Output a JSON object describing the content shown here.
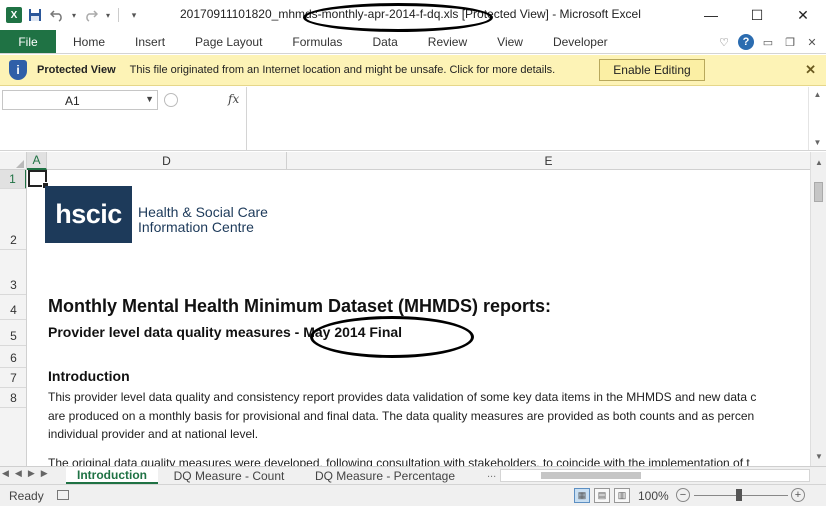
{
  "window": {
    "title": "20170911101820_mhmds-monthly-apr-2014-f-dq.xls  [Protected View]  -  Microsoft Excel",
    "app_icon": "X",
    "controls": {
      "minimize": "—",
      "maximize": "☐",
      "close": "✕"
    }
  },
  "ribbon": {
    "file": "File",
    "tabs": [
      "Home",
      "Insert",
      "Page Layout",
      "Formulas",
      "Data",
      "Review",
      "View",
      "Developer"
    ]
  },
  "protected_view": {
    "icon": "i",
    "title": "Protected View",
    "message": "This file originated from an Internet location and might be unsafe. Click for more details.",
    "enable_button": "Enable Editing",
    "close": "✕"
  },
  "formula_bar": {
    "name_box": "A1",
    "fx": "fx",
    "formula": ""
  },
  "grid": {
    "columns": [
      {
        "label": "A",
        "selected": true
      },
      {
        "label": "D",
        "selected": false
      },
      {
        "label": "E",
        "selected": false
      }
    ],
    "rows": [
      {
        "label": "1",
        "selected": true
      },
      {
        "label": "2",
        "selected": false
      },
      {
        "label": "3",
        "selected": false
      },
      {
        "label": "4",
        "selected": false
      },
      {
        "label": "5",
        "selected": false
      },
      {
        "label": "6",
        "selected": false
      },
      {
        "label": "7",
        "selected": false
      },
      {
        "label": "8",
        "selected": false
      }
    ]
  },
  "content": {
    "logo_mark": "hscic",
    "logo_line1": "Health & Social Care",
    "logo_line2": "Information Centre",
    "main_heading": "Monthly Mental Health Minimum Dataset (MHMDS) reports:",
    "sub_heading": "Provider level data quality measures - May 2014 Final",
    "intro_heading": "Introduction",
    "intro_lines": [
      "This provider level data quality and consistency report provides data validation of some key data items in the MHMDS and new data c",
      "are produced on a monthly basis for provisional and final data. The data quality measures are provided as both counts and as percen",
      "individual provider and at national level."
    ],
    "intro_line_cut": "The original data quality measures were developed, following consultation with stakeholders, to coincide with the implementation of t"
  },
  "sheet_tabs": {
    "tabs": [
      "Introduction",
      "DQ Measure - Count",
      "DQ Measure - Percentage"
    ],
    "active_index": 0,
    "more": "..."
  },
  "status_bar": {
    "status": "Ready",
    "zoom": "100%",
    "zoom_minus": "−",
    "zoom_plus": "+"
  },
  "icons": {
    "save": "save-icon",
    "undo": "undo-icon",
    "redo": "redo-icon",
    "customize_qat": "customize-icon",
    "ribbon_minimize": "chevron-up-icon",
    "help": "help-icon"
  }
}
